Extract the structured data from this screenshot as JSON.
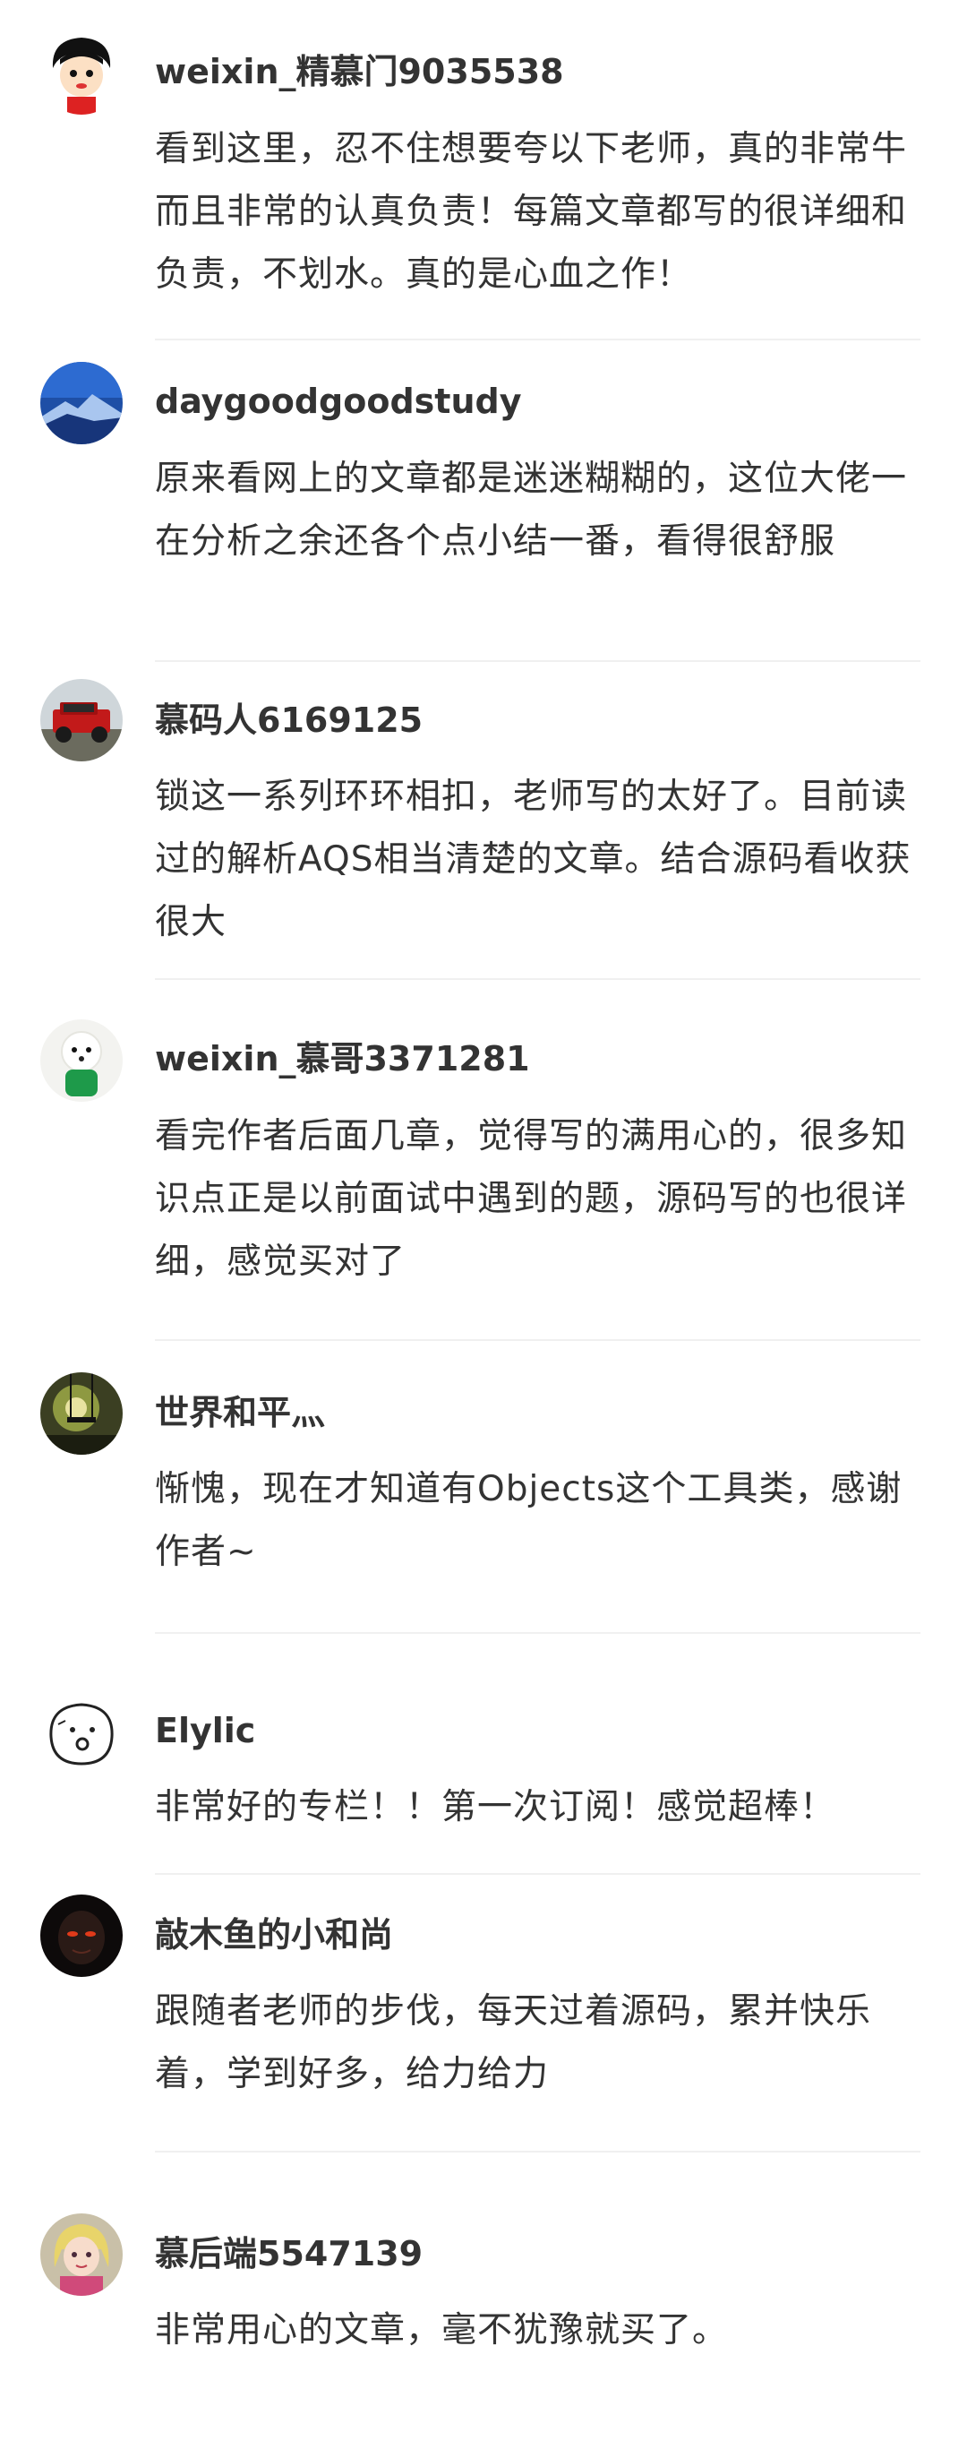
{
  "comments": [
    {
      "username": "weixin_精慕门9035538",
      "text": "看到这里，忍不住想要夸以下老师，真的非常牛而且非常的认真负责！每篇文章都写的很详细和负责，不划水。真的是心血之作！",
      "avatar_icon": "cartoon-boy-avatar-icon"
    },
    {
      "username": "daygoodgoodstudy",
      "text": "原来看网上的文章都是迷迷糊糊的，这位大佬一在分析之余还各个点小结一番，看得很舒服",
      "avatar_icon": "blue-mountain-avatar-icon"
    },
    {
      "username": "慕码人6169125",
      "text": "锁这一系列环环相扣，老师写的太好了。目前读过的解析AQS相当清楚的文章。结合源码看收获很大",
      "avatar_icon": "red-car-avatar-icon"
    },
    {
      "username": "weixin_慕哥3371281",
      "text": "看完作者后面几章，觉得写的满用心的，很多知识点正是以前面试中遇到的题，源码写的也很详细，感觉买对了",
      "avatar_icon": "white-puppy-avatar-icon"
    },
    {
      "username": "世界和平灬",
      "text": "惭愧，现在才知道有Objects这个工具类，感谢作者~",
      "avatar_icon": "swing-sunset-avatar-icon"
    },
    {
      "username": "Elylic",
      "text": "非常好的专栏！！第一次订阅！感觉超棒！",
      "avatar_icon": "sketch-face-avatar-icon"
    },
    {
      "username": "敲木鱼的小和尚",
      "text": "跟随者老师的步伐，每天过着源码，累并快乐着，学到好多，给力给力",
      "avatar_icon": "dark-figure-avatar-icon"
    },
    {
      "username": "慕后端5547139",
      "text": "非常用心的文章，毫不犹豫就买了。",
      "avatar_icon": "anime-girl-avatar-icon"
    }
  ],
  "colors": {
    "username": "#333333",
    "text": "#333333",
    "divider": "#f0f0f0"
  }
}
